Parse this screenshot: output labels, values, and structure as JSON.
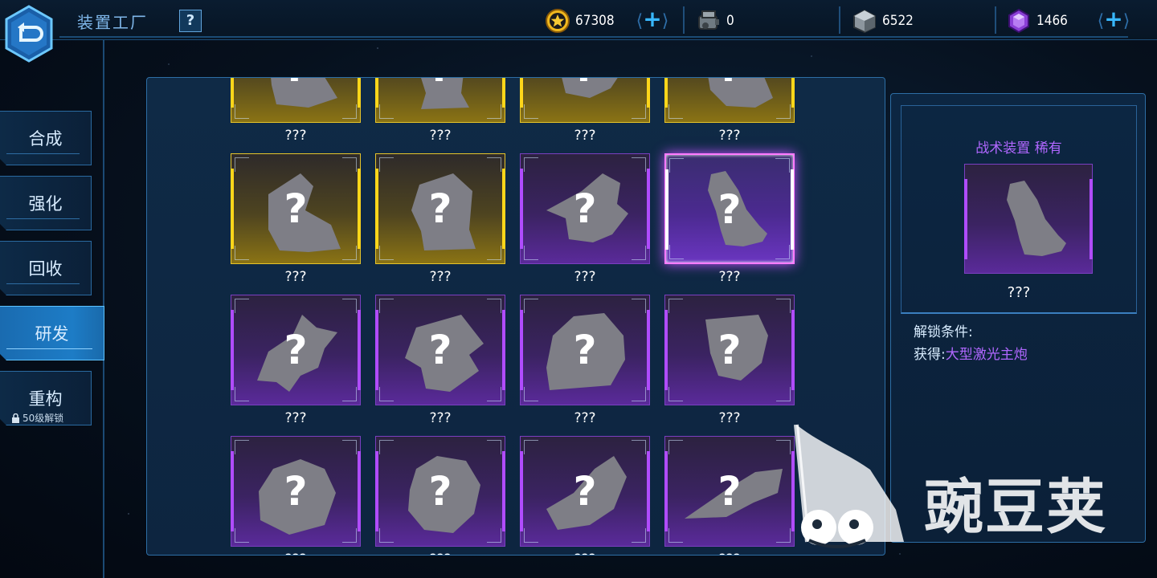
{
  "header": {
    "title": "装置工厂",
    "help_label": "?"
  },
  "resources": {
    "coins": {
      "icon": "gold-coin-icon",
      "value": "67308"
    },
    "engines": {
      "icon": "engine-part-icon",
      "value": "0"
    },
    "cubes": {
      "icon": "metal-cube-icon",
      "value": "6522"
    },
    "gems": {
      "icon": "purple-crystal-icon",
      "value": "1466"
    },
    "plus_label": "+"
  },
  "menu": {
    "items": [
      {
        "label": "合成",
        "active": false
      },
      {
        "label": "强化",
        "active": false
      },
      {
        "label": "回收",
        "active": false
      },
      {
        "label": "研发",
        "active": true
      },
      {
        "label": "重构",
        "active": false
      }
    ],
    "lock_note": "50级解锁"
  },
  "grid": {
    "items": [
      {
        "name": "???",
        "rarity": "gold",
        "shape": "a"
      },
      {
        "name": "???",
        "rarity": "gold",
        "shape": "b"
      },
      {
        "name": "???",
        "rarity": "gold",
        "shape": "c"
      },
      {
        "name": "???",
        "rarity": "gold",
        "shape": "d"
      },
      {
        "name": "???",
        "rarity": "gold",
        "shape": "e"
      },
      {
        "name": "???",
        "rarity": "gold",
        "shape": "f"
      },
      {
        "name": "???",
        "rarity": "purple",
        "shape": "g"
      },
      {
        "name": "???",
        "rarity": "purple",
        "shape": "h",
        "selected": true
      },
      {
        "name": "???",
        "rarity": "purple",
        "shape": "i"
      },
      {
        "name": "???",
        "rarity": "purple",
        "shape": "j"
      },
      {
        "name": "???",
        "rarity": "purple",
        "shape": "k"
      },
      {
        "name": "???",
        "rarity": "purple",
        "shape": "l"
      },
      {
        "name": "???",
        "rarity": "purple",
        "shape": "m"
      },
      {
        "name": "???",
        "rarity": "purple",
        "shape": "n"
      },
      {
        "name": "???",
        "rarity": "purple",
        "shape": "o"
      },
      {
        "name": "???",
        "rarity": "purple",
        "shape": "p"
      }
    ],
    "mystery_mark": "?"
  },
  "detail": {
    "rarity_label": "战术装置 稀有",
    "name": "???",
    "unlock_title": "解锁条件:",
    "unlock_prefix": "获得:",
    "unlock_item": "大型激光主炮"
  },
  "watermark": {
    "text": "豌豆荚"
  },
  "colors": {
    "gold": "#ffd61a",
    "purple": "#b04cff",
    "accent": "#38b8ff",
    "rarity_text": "#b067ff"
  }
}
